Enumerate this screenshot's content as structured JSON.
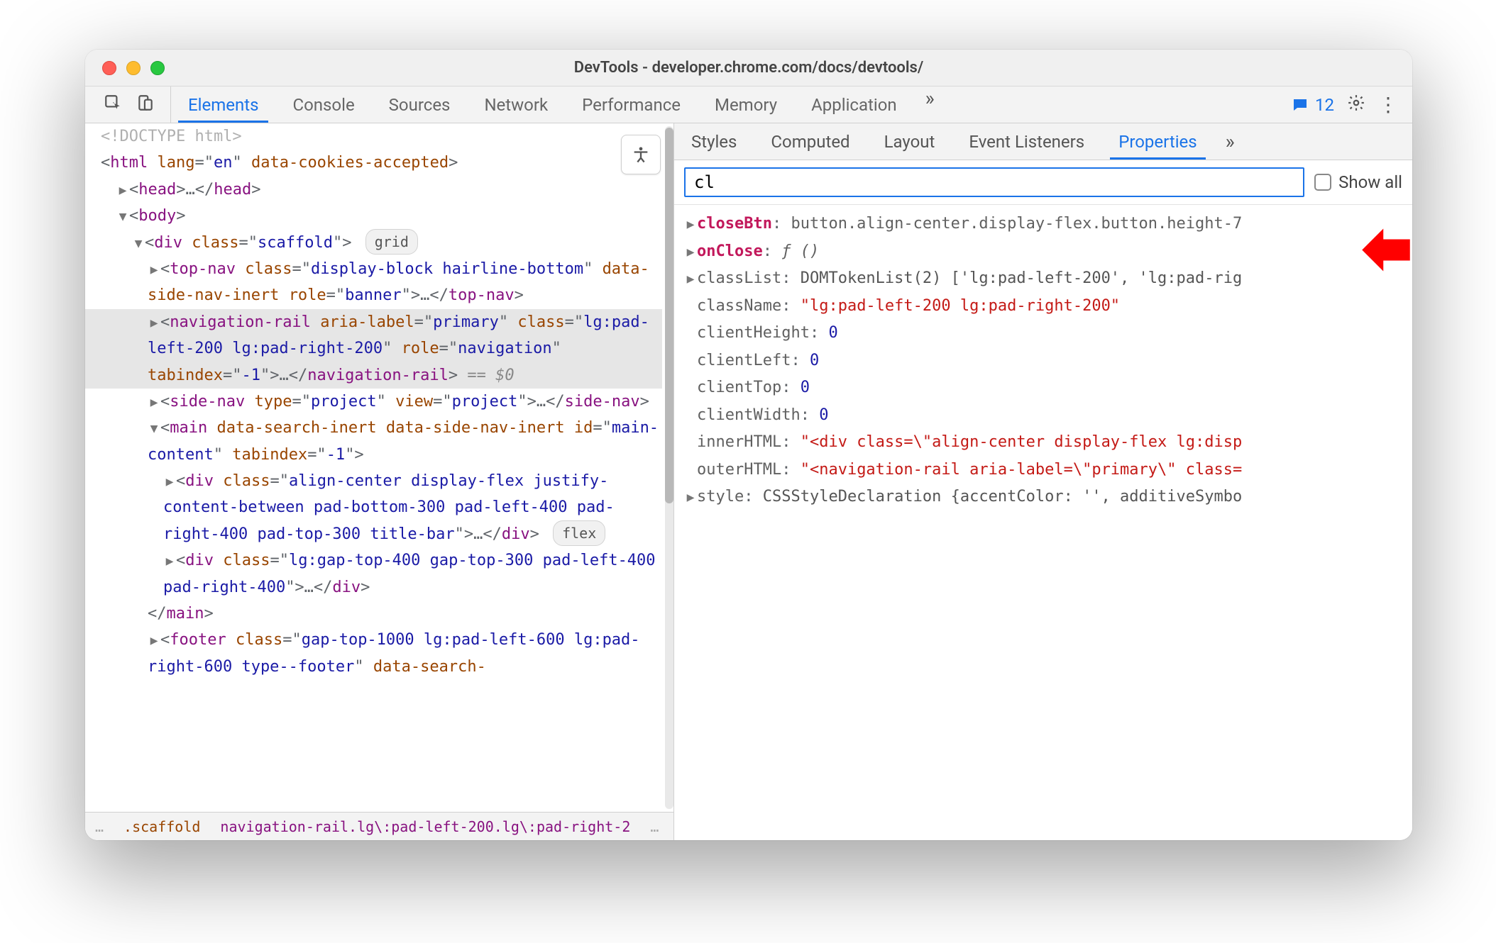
{
  "window": {
    "title": "DevTools - developer.chrome.com/docs/devtools/"
  },
  "toolbar": {
    "tabs": {
      "elements": "Elements",
      "console": "Console",
      "sources": "Sources",
      "network": "Network",
      "performance": "Performance",
      "memory": "Memory",
      "application": "Application"
    },
    "activeTab": "elements",
    "overflow": "»",
    "issues_count": "12"
  },
  "dom": {
    "doctype": "<!DOCTYPE html>",
    "html_open": {
      "tag": "html",
      "attrs": "lang=\"en\" data-cookies-accepted"
    },
    "head": {
      "tag": "head",
      "ellipsis": "…"
    },
    "body_open": {
      "tag": "body"
    },
    "div_scaffold": {
      "tag": "div",
      "attrs": "class=\"scaffold\"",
      "badge": "grid"
    },
    "topnav": {
      "open": "<top-nav class=\"display-block hairline-bottom\" data-side-nav-inert role=\"banner\">",
      "ellipsis": "…",
      "close": "</top-nav>"
    },
    "navrail": {
      "open": "<navigation-rail aria-label=\"primary\" class=\"lg:pad-left-200 lg:pad-right-200\" role=\"navigation\" tabindex=\"-1\">",
      "ellipsis": "…",
      "close": "</navigation-rail>",
      "match": " == $0"
    },
    "sidenav": {
      "open": "<side-nav type=\"project\" view=\"project\">",
      "ellipsis": "…",
      "close": "</side-nav>"
    },
    "main": {
      "open": "<main data-search-inert data-side-nav-inert id=\"main-content\" tabindex=\"-1\">"
    },
    "div_titlebar": {
      "open": "<div class=\"align-center display-flex justify-content-between pad-bottom-300 pad-left-400 pad-right-400 pad-top-300 title-bar\">",
      "ellipsis": "…",
      "close": "</div>",
      "badge": "flex"
    },
    "div_gap": {
      "open": "<div class=\"lg:gap-top-400 gap-top-300 pad-left-400 pad-right-400\">",
      "ellipsis": "…",
      "close": "</div>"
    },
    "main_close": "</main>",
    "footer": {
      "open": "<footer class=\"gap-top-1000 lg:pad-left-600 lg:pad-right-600 type--footer\" data-search-"
    }
  },
  "breadcrumbs": {
    "ellipsis_left": "…",
    "scaffold": ".scaffold",
    "navrail": "navigation-rail.lg\\:pad-left-200.lg\\:pad-right-2",
    "ellipsis_right": "…"
  },
  "rightPane": {
    "tabs": {
      "styles": "Styles",
      "computed": "Computed",
      "layout": "Layout",
      "listeners": "Event Listeners",
      "properties": "Properties"
    },
    "activeTab": "properties",
    "overflow": "»",
    "filter_value": "cl",
    "show_all_label": "Show all",
    "show_all_checked": false
  },
  "props": [
    {
      "expand": true,
      "key": "closeBtn",
      "bold": true,
      "valueType": "sel",
      "value": "button.align-center.display-flex.button.height-7"
    },
    {
      "expand": true,
      "key": "onClose",
      "bold": true,
      "valueType": "func",
      "value": "ƒ ()"
    },
    {
      "expand": true,
      "key": "classList",
      "bold": false,
      "valueType": "obj",
      "value": "DOMTokenList(2) ['lg:pad-left-200', 'lg:pad-rig"
    },
    {
      "expand": false,
      "key": "className",
      "bold": false,
      "valueType": "str",
      "value": "\"lg:pad-left-200 lg:pad-right-200\""
    },
    {
      "expand": false,
      "key": "clientHeight",
      "bold": false,
      "valueType": "num",
      "value": "0"
    },
    {
      "expand": false,
      "key": "clientLeft",
      "bold": false,
      "valueType": "num",
      "value": "0"
    },
    {
      "expand": false,
      "key": "clientTop",
      "bold": false,
      "valueType": "num",
      "value": "0"
    },
    {
      "expand": false,
      "key": "clientWidth",
      "bold": false,
      "valueType": "num",
      "value": "0"
    },
    {
      "expand": false,
      "key": "innerHTML",
      "bold": false,
      "valueType": "str",
      "value": "\"<div class=\\\"align-center display-flex lg:disp"
    },
    {
      "expand": false,
      "key": "outerHTML",
      "bold": false,
      "valueType": "str",
      "value": "\"<navigation-rail aria-label=\\\"primary\\\" class="
    },
    {
      "expand": true,
      "key": "style",
      "bold": false,
      "valueType": "obj",
      "value": "CSSStyleDeclaration {accentColor: '', additiveSymbo"
    }
  ]
}
